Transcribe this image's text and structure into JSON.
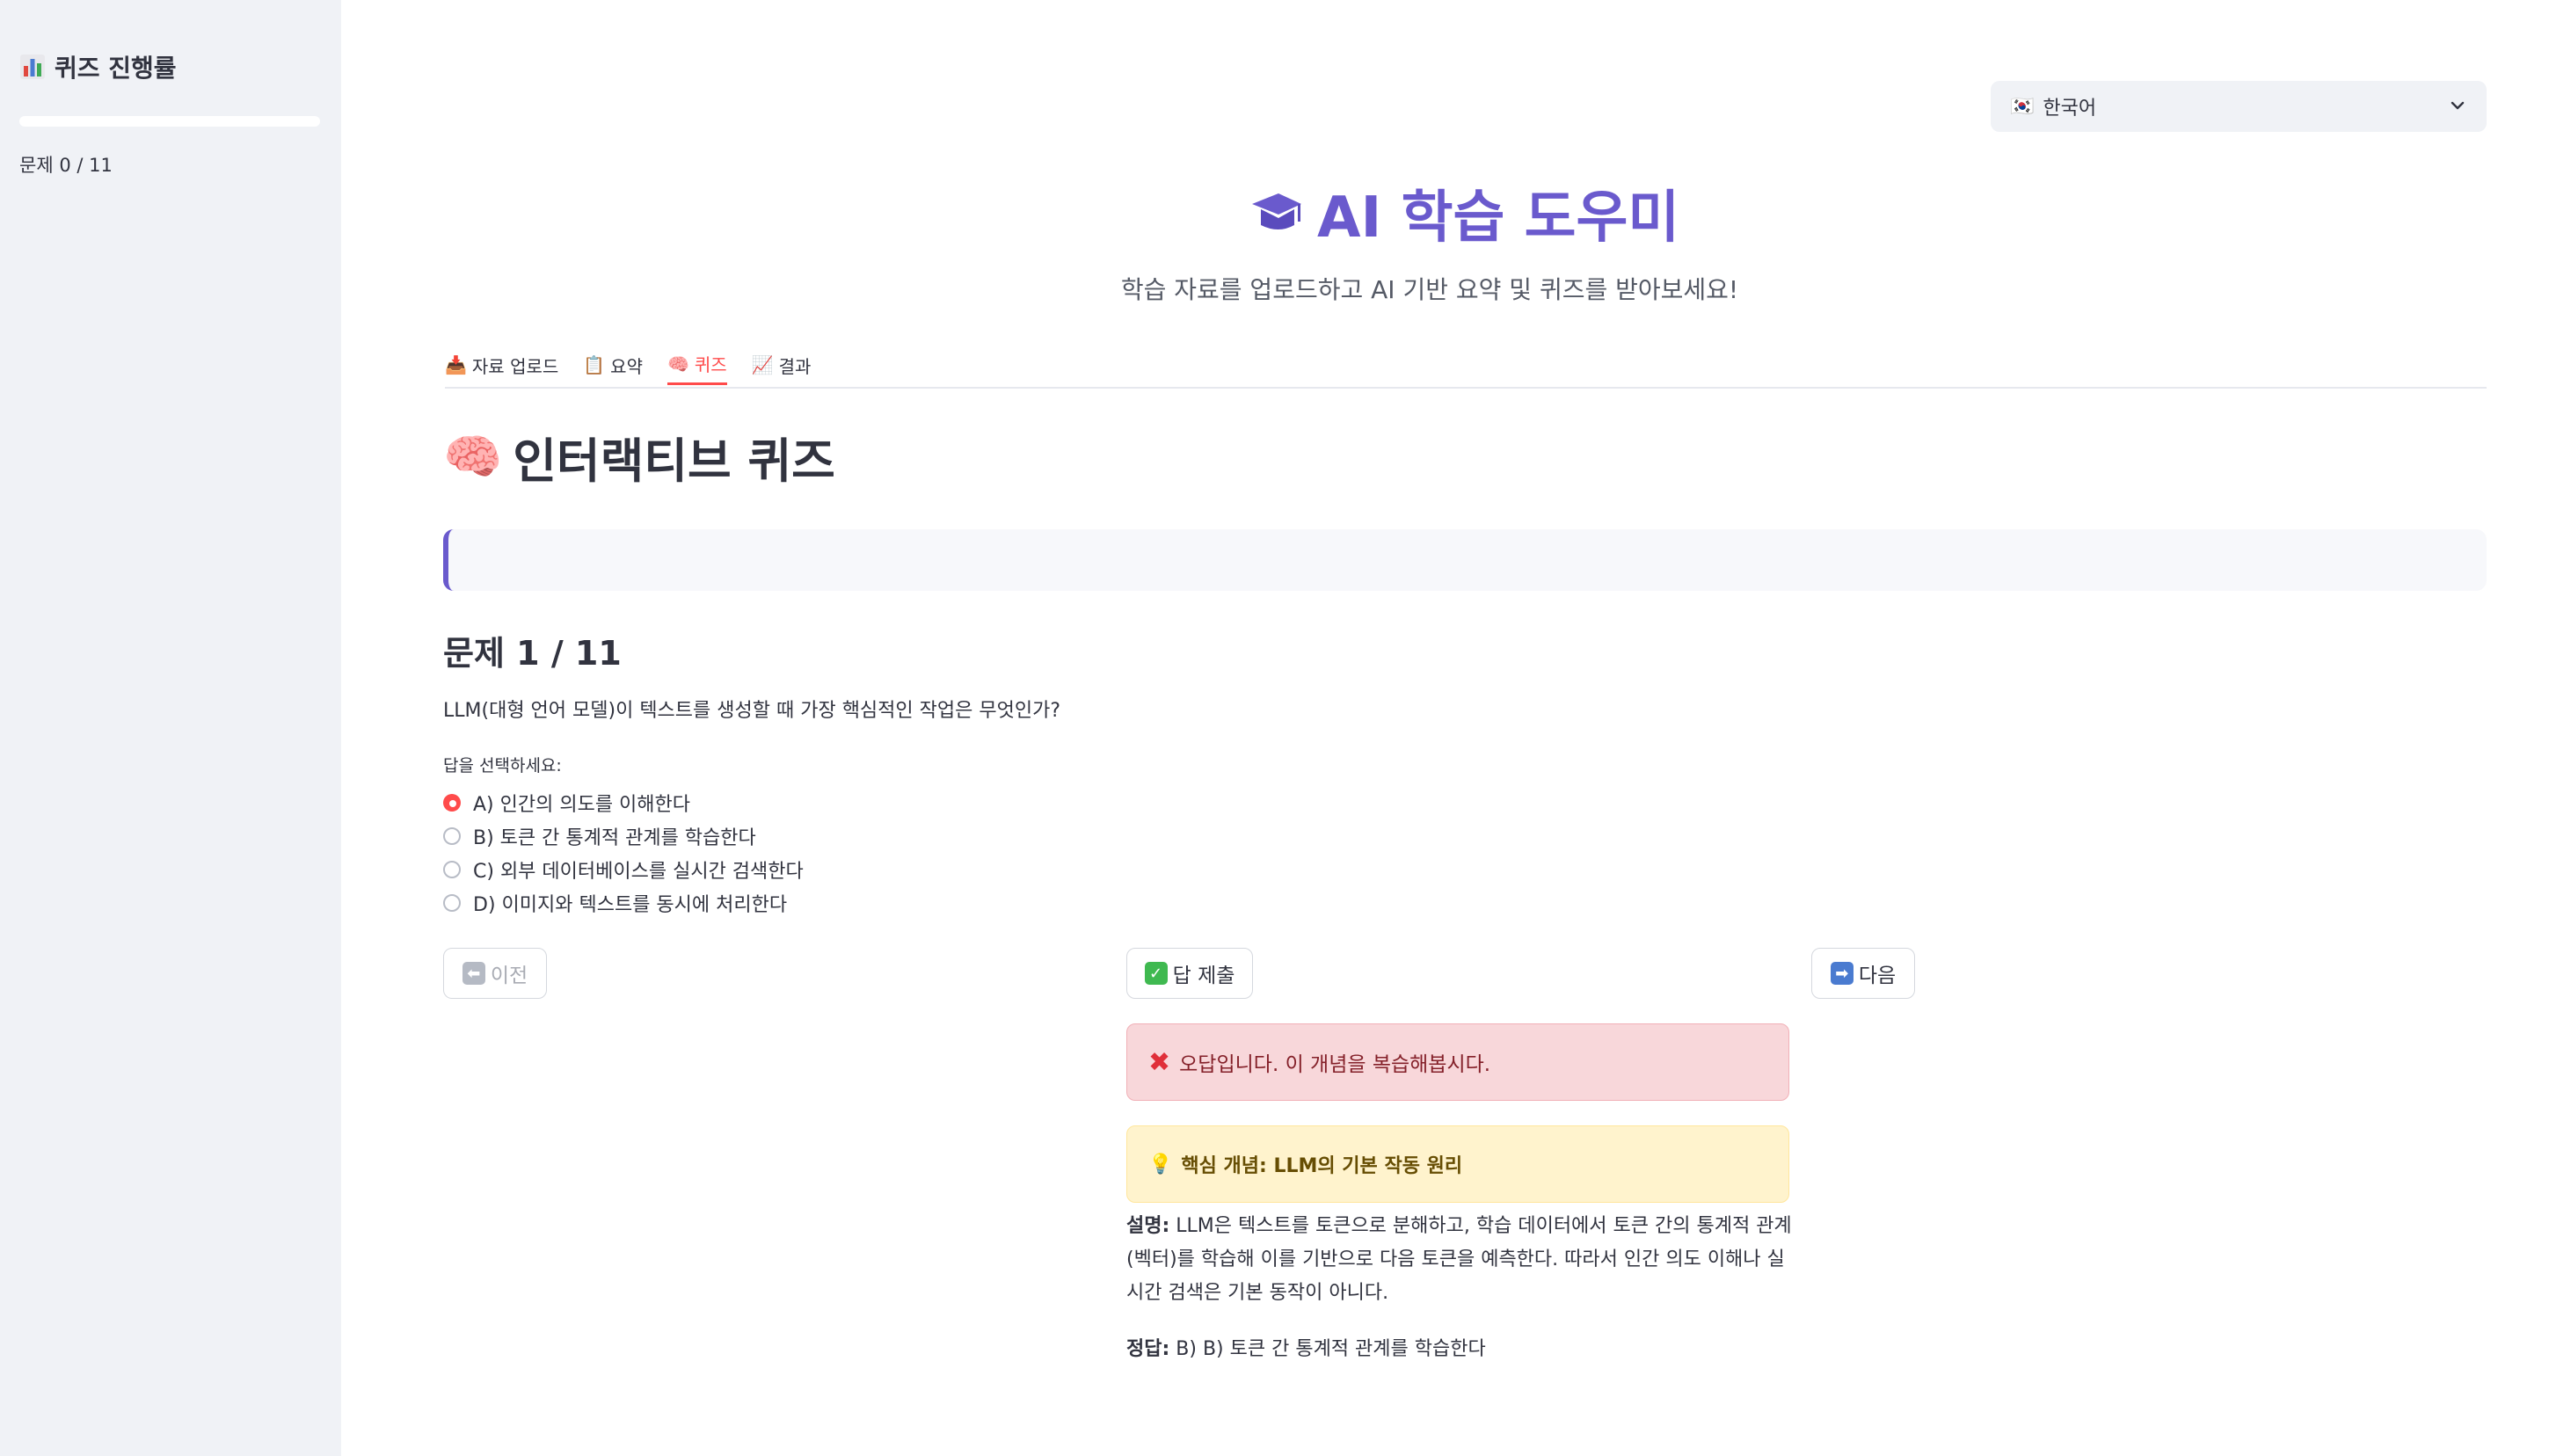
{
  "sidebar": {
    "title": "퀴즈 진행률",
    "progress": 0,
    "count_text": "문제 0 / 11"
  },
  "language": {
    "selected": "한국어",
    "flag": "🇰🇷"
  },
  "header": {
    "title": "AI 학습 도우미",
    "subtitle": "학습 자료를 업로드하고 AI 기반 요약 및 퀴즈를 받아보세요!"
  },
  "tabs": [
    {
      "label": "자료 업로드",
      "icon": "📥"
    },
    {
      "label": "요약",
      "icon": "📋"
    },
    {
      "label": "퀴즈",
      "icon": "🧠",
      "active": true
    },
    {
      "label": "결과",
      "icon": "📈"
    }
  ],
  "quiz": {
    "section_title": "인터랙티브 퀴즈",
    "question_heading": "문제 1 / 11",
    "question_text": "LLM(대형 언어 모델)이 텍스트를 생성할 때 가장 핵심적인 작업은 무엇인가?",
    "choose_label": "답을 선택하세요:",
    "options": [
      "A) 인간의 의도를 이해한다",
      "B) 토큰 간 통계적 관계를 학습한다",
      "C) 외부 데이터베이스를 실시간 검색한다",
      "D) 이미지와 텍스트를 동시에 처리한다"
    ],
    "selected_index": 0,
    "buttons": {
      "prev": "이전",
      "submit": "답 제출",
      "next": "다음"
    }
  },
  "feedback": {
    "error_text": "오답입니다. 이 개념을 복습해봅시다.",
    "concept_text": "핵심 개념: LLM의 기본 작동 원리",
    "explain_label": "설명:",
    "explain_text": "LLM은 텍스트를 토큰으로 분해하고, 학습 데이터에서 토큰 간의 통계적 관계(벡터)를 학습해 이를 기반으로 다음 토큰을 예측한다. 따라서 인간 의도 이해나 실시간 검색은 기본 동작이 아니다.",
    "answer_label": "정답:",
    "answer_text": "B) B) 토큰 간 통계적 관계를 학습한다"
  },
  "colors": {
    "accent": "#6a5acd",
    "tab_active": "#ff4b4b",
    "sidebar_bg": "#f0f2f6",
    "error_bg": "#f8d7da",
    "warn_bg": "#fff3cd"
  }
}
